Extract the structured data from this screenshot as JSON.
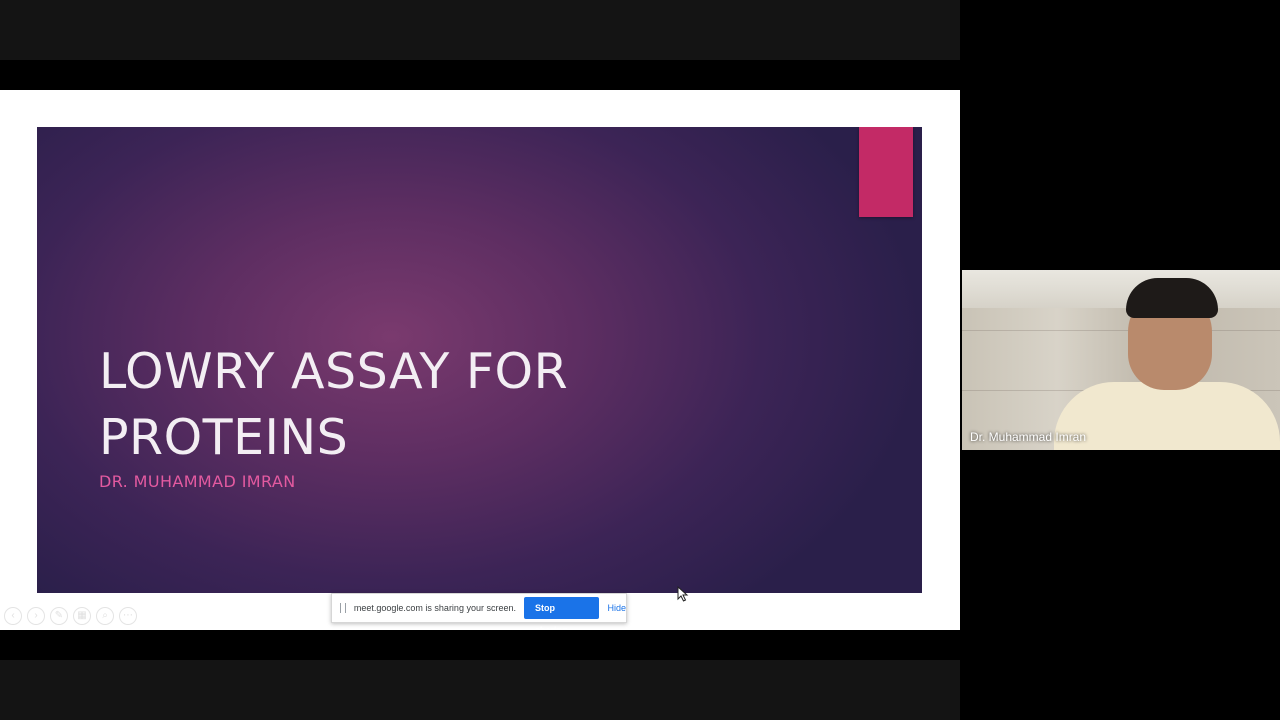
{
  "slide": {
    "title_line1": "LOWRY ASSAY FOR",
    "title_line2": "PROTEINS",
    "subtitle": "DR. MUHAMMAD IMRAN",
    "accent_color": "#c32a66"
  },
  "slide_controls": [
    {
      "icon": "previous-icon",
      "glyph": "‹"
    },
    {
      "icon": "next-icon",
      "glyph": "›"
    },
    {
      "icon": "pen-icon",
      "glyph": "✎"
    },
    {
      "icon": "slides-icon",
      "glyph": "▦"
    },
    {
      "icon": "zoom-icon",
      "glyph": "⌕"
    },
    {
      "icon": "more-icon",
      "glyph": "⋯"
    }
  ],
  "share_bar": {
    "message": "meet.google.com is sharing your screen.",
    "stop_label": "Stop sharing",
    "hide_label": "Hide"
  },
  "participant": {
    "name": "Dr. Muhammad Imran"
  }
}
